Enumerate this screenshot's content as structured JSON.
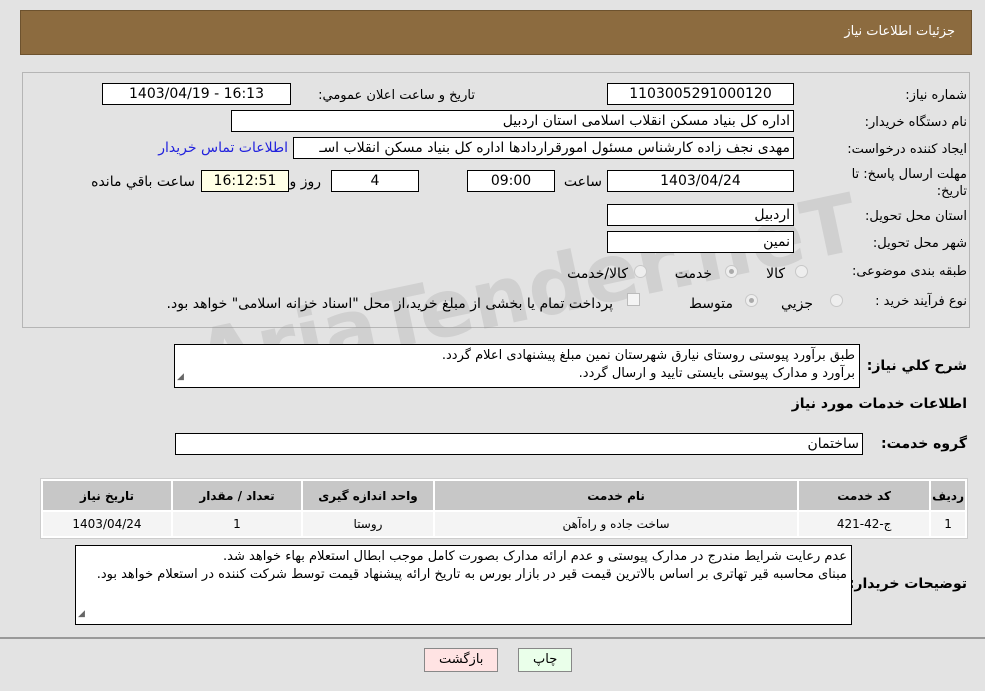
{
  "header": {
    "title": "جزئیات اطلاعات نیاز"
  },
  "fields": {
    "need_number_label": "شماره نیاز:",
    "need_number": "1103005291000120",
    "announce_label": "تاریخ و ساعت اعلان عمومي:",
    "announce_value": "1403/04/19 - 16:13",
    "buyer_label": "نام دستگاه خریدار:",
    "buyer": "اداره کل بنیاد مسکن انقلاب اسلامی استان اردبیل",
    "creator_label": "ایجاد کننده درخواست:",
    "creator": "مهدی نجف زاده کارشناس مسئول امورقراردادها اداره کل بنیاد مسکن انقلاب اسـ",
    "contact_link": "اطلاعات تماس خریدار",
    "deadline_label": "مهلت ارسال پاسخ: تا تاریخ:",
    "deadline_date": "1403/04/24",
    "time_label": "ساعت",
    "deadline_time": "09:00",
    "days": "4",
    "days_label": "روز و",
    "remaining": "16:12:51",
    "remaining_label": "ساعت باقي مانده",
    "province_label": "استان محل تحویل:",
    "province": "اردبیل",
    "city_label": "شهر محل تحویل:",
    "city": "نمین",
    "category_label": "طبقه بندی موضوعی:",
    "category_options": [
      "کالا",
      "خدمت",
      "کالا/خدمت"
    ],
    "category_selected": "خدمت",
    "process_label": "نوع فرآیند خرید :",
    "process_options": [
      "جزيي",
      "متوسط"
    ],
    "process_selected": "متوسط",
    "payment_note": "پرداخت تمام یا بخشی از مبلغ خرید،از محل \"اسناد خزانه اسلامی\" خواهد بود."
  },
  "description": {
    "label": "شرح کلي نياز:",
    "line1": "طبق برآورد پیوستی روستای نیارق شهرستان نمین مبلغ پیشنهادی اعلام گردد.",
    "line2": "برآورد و مدارک پیوستی بایستی تایید و ارسال گردد."
  },
  "services": {
    "title": "اطلاعات خدمات مورد نیاز",
    "group_label": "گروه خدمت:",
    "group": "ساختمان",
    "columns": [
      "ردیف",
      "کد خدمت",
      "نام خدمت",
      "واحد اندازه گیری",
      "تعداد / مقدار",
      "تاریخ نیاز"
    ],
    "rows": [
      [
        "1",
        "ج-42-421",
        "ساخت جاده و راه‌آهن",
        "روستا",
        "1",
        "1403/04/24"
      ]
    ]
  },
  "buyer_notes": {
    "label": "توضیحات خریدار:",
    "line1": "عدم رعایت شرایط مندرج در مدارک پیوستی و عدم ارائه مدارک بصورت کامل موجب ابطال استعلام بهاء خواهد شد.",
    "line2": "مبنای محاسبه قیر تهاتری بر اساس بالاترین قیمت قیر در بازار بورس به تاریخ ارائه پیشنهاد قیمت توسط شرکت کننده در استعلام خواهد بود."
  },
  "buttons": {
    "print": "چاپ",
    "back": "بازگشت"
  },
  "watermark": "AriaTender.neT"
}
